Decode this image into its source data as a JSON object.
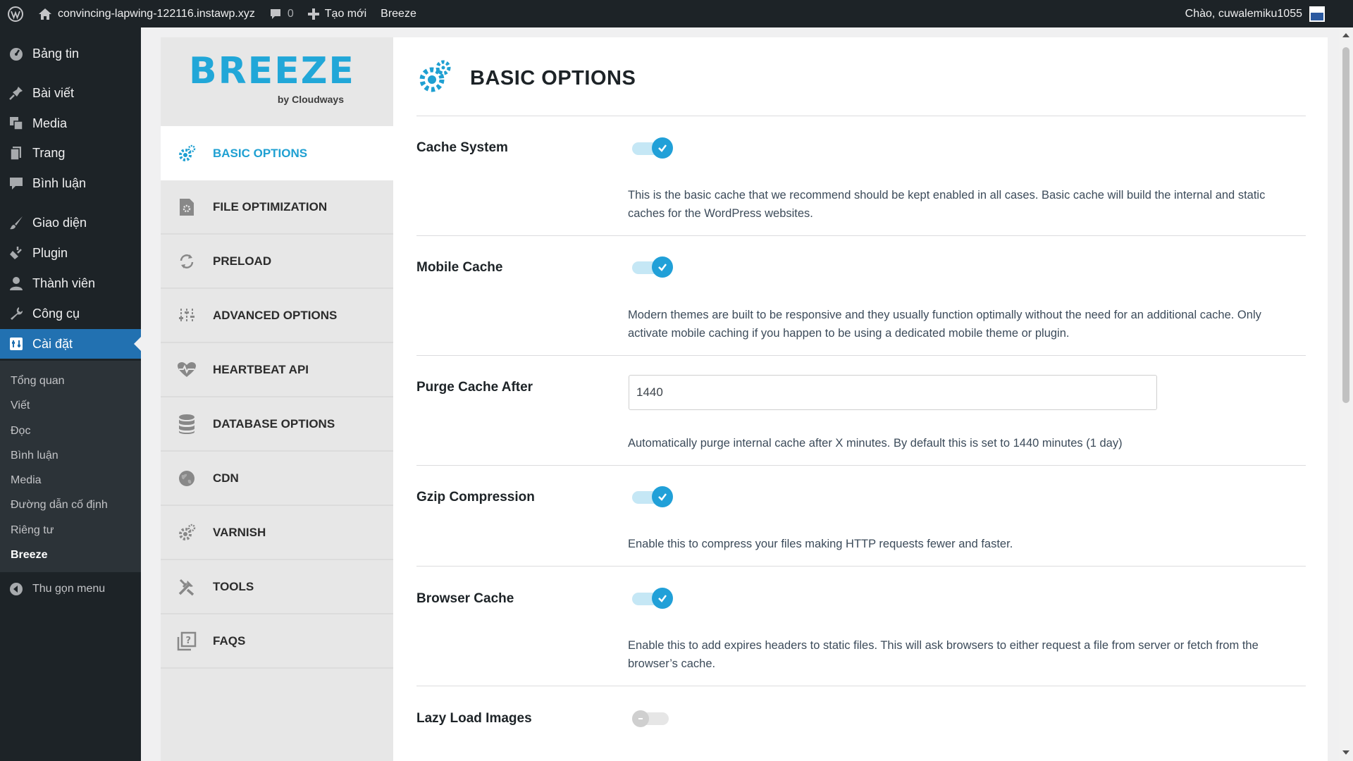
{
  "adminbar": {
    "site_name": "convincing-lapwing-122116.instawp.xyz",
    "comments_count": "0",
    "new_label": "Tạo mới",
    "plugin_label": "Breeze",
    "greeting": "Chào, cuwalemiku1055"
  },
  "sidebar": {
    "items": [
      {
        "label": "Bảng tin",
        "icon": "dashboard-icon"
      },
      {
        "label": "Bài viết",
        "icon": "pin-icon"
      },
      {
        "label": "Media",
        "icon": "media-icon"
      },
      {
        "label": "Trang",
        "icon": "page-icon"
      },
      {
        "label": "Bình luận",
        "icon": "comment-icon"
      },
      {
        "label": "Giao diện",
        "icon": "brush-icon"
      },
      {
        "label": "Plugin",
        "icon": "plugin-icon"
      },
      {
        "label": "Thành viên",
        "icon": "user-icon"
      },
      {
        "label": "Công cụ",
        "icon": "wrench-icon"
      },
      {
        "label": "Cài đặt",
        "icon": "settings-icon"
      }
    ],
    "submenu": [
      "Tổng quan",
      "Viết",
      "Đọc",
      "Bình luận",
      "Media",
      "Đường dẫn cố định",
      "Riêng tư",
      "Breeze"
    ],
    "collapse_label": "Thu gọn menu"
  },
  "breeze": {
    "logo_text": "BREEZE",
    "logo_sub": "by Cloudways",
    "nav": [
      {
        "label": "BASIC OPTIONS",
        "icon": "gear-icon"
      },
      {
        "label": "FILE OPTIMIZATION",
        "icon": "file-gear-icon"
      },
      {
        "label": "PRELOAD",
        "icon": "refresh-icon"
      },
      {
        "label": "ADVANCED OPTIONS",
        "icon": "sliders-icon"
      },
      {
        "label": "HEARTBEAT API",
        "icon": "heartbeat-icon"
      },
      {
        "label": "DATABASE OPTIONS",
        "icon": "database-icon"
      },
      {
        "label": "CDN",
        "icon": "globe-icon"
      },
      {
        "label": "VARNISH",
        "icon": "gear-icon"
      },
      {
        "label": "TOOLS",
        "icon": "tools-icon"
      },
      {
        "label": "FAQS",
        "icon": "faq-icon"
      }
    ]
  },
  "main": {
    "title": "BASIC OPTIONS",
    "options": [
      {
        "label": "Cache System",
        "enabled": true,
        "desc": "This is the basic cache that we recommend should be kept enabled in all cases. Basic cache will build the internal and static caches for the WordPress websites."
      },
      {
        "label": "Mobile Cache",
        "enabled": true,
        "desc": "Modern themes are built to be responsive and they usually function optimally without the need for an additional cache. Only activate mobile caching if you happen to be using a dedicated mobile theme or plugin."
      },
      {
        "label": "Purge Cache After",
        "value": "1440",
        "desc": "Automatically purge internal cache after X minutes. By default this is set to 1440 minutes (1 day)"
      },
      {
        "label": "Gzip Compression",
        "enabled": true,
        "desc": "Enable this to compress your files making HTTP requests fewer and faster."
      },
      {
        "label": "Browser Cache",
        "enabled": true,
        "desc": "Enable this to add expires headers to static files. This will ask browsers to either request a file from server or fetch from the browser’s cache."
      },
      {
        "label": "Lazy Load Images",
        "enabled": false
      }
    ]
  },
  "colors": {
    "accent": "#21a0d8",
    "wp_blue": "#2271b1",
    "admin_dark": "#1d2327"
  }
}
